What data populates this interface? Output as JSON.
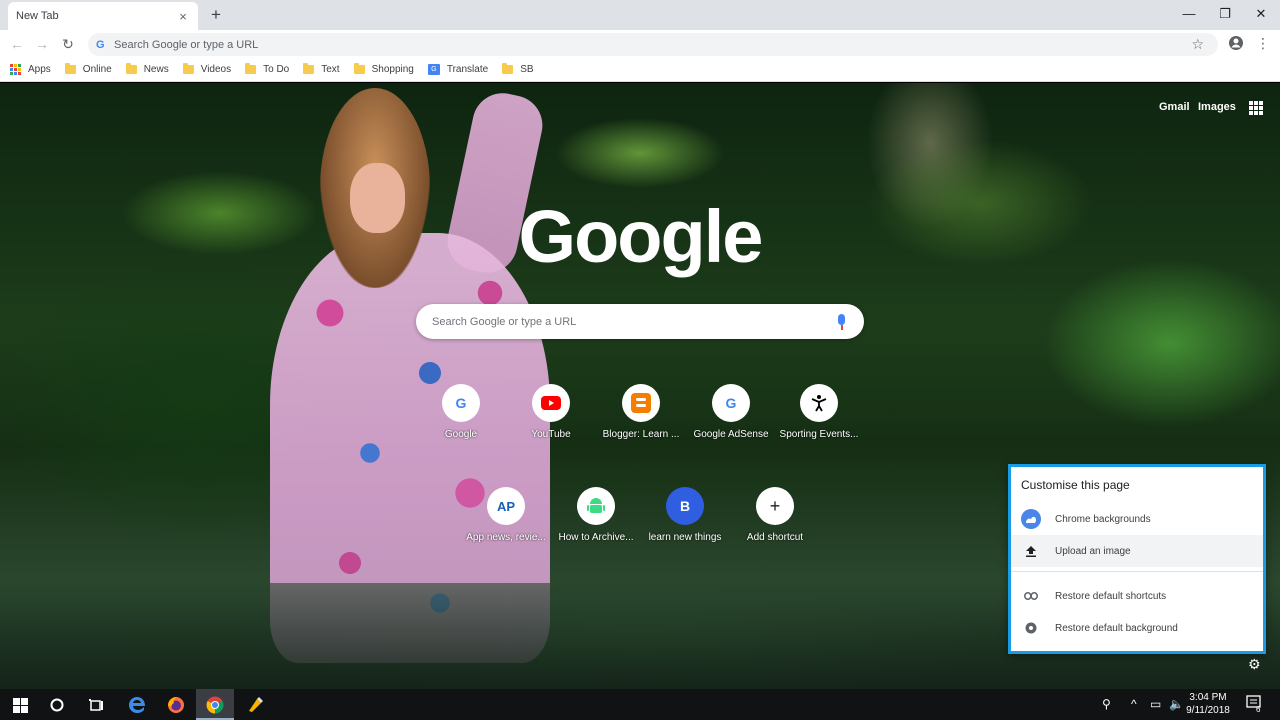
{
  "browser": {
    "tab_title": "New Tab",
    "tab_close": "×",
    "new_tab": "+",
    "window_controls": {
      "minimize": "—",
      "maximize": "❐",
      "close": "✕"
    },
    "omnibox_placeholder": "Search Google or type a URL"
  },
  "bookmarks": [
    {
      "label": "Apps",
      "icon": "apps-grid-icon"
    },
    {
      "label": "Online",
      "icon": "folder-icon"
    },
    {
      "label": "News",
      "icon": "folder-icon"
    },
    {
      "label": "Videos",
      "icon": "folder-icon"
    },
    {
      "label": "To Do",
      "icon": "folder-icon"
    },
    {
      "label": "Text",
      "icon": "folder-icon"
    },
    {
      "label": "Shopping",
      "icon": "folder-icon"
    },
    {
      "label": "Translate",
      "icon": "translate-icon"
    },
    {
      "label": "SB",
      "icon": "folder-icon"
    }
  ],
  "ntp": {
    "links": {
      "gmail": "Gmail",
      "images": "Images"
    },
    "logo": "Google",
    "search_placeholder": "Search Google or type a URL",
    "shortcuts": [
      {
        "label": "Google",
        "icon_text": "G",
        "icon_color": "#4285f4",
        "icon_bg": "#ffffff"
      },
      {
        "label": "YouTube",
        "icon_text": "▶",
        "icon_color": "#ffffff",
        "icon_bg": "#ff0000"
      },
      {
        "label": "Blogger: Learn ...",
        "icon_text": "B",
        "icon_color": "#ffffff",
        "icon_bg": "#f57d00"
      },
      {
        "label": "Google AdSense",
        "icon_text": "G",
        "icon_color": "#4285f4",
        "icon_bg": "#ffffff"
      },
      {
        "label": "Sporting Events...",
        "icon_text": "🏃",
        "icon_color": "#000000",
        "icon_bg": "#ffffff"
      },
      {
        "label": "App news, revie...",
        "icon_text": "AP",
        "icon_color": "#1a5fb4",
        "icon_bg": "#ffffff"
      },
      {
        "label": "How to Archive...",
        "icon_text": "🤖",
        "icon_color": "#3ddc84",
        "icon_bg": "#ffffff"
      },
      {
        "label": "learn new things",
        "icon_text": "B",
        "icon_color": "#ffffff",
        "icon_bg": "#2f5fe0"
      },
      {
        "label": "Add shortcut",
        "icon_text": "+",
        "icon_color": "#202124",
        "icon_bg": "#ffffff"
      }
    ]
  },
  "customise": {
    "title": "Customise this page",
    "items": [
      {
        "label": "Chrome backgrounds",
        "icon": "chrome-backgrounds-icon"
      },
      {
        "label": "Upload an image",
        "icon": "upload-icon"
      },
      {
        "label": "Restore default shortcuts",
        "icon": "link-icon"
      },
      {
        "label": "Restore default background",
        "icon": "restore-background-icon"
      }
    ],
    "accent": "#1a9be6"
  },
  "taskbar": {
    "time": "3:04 PM",
    "date": "9/11/2018",
    "notifications": "6"
  }
}
